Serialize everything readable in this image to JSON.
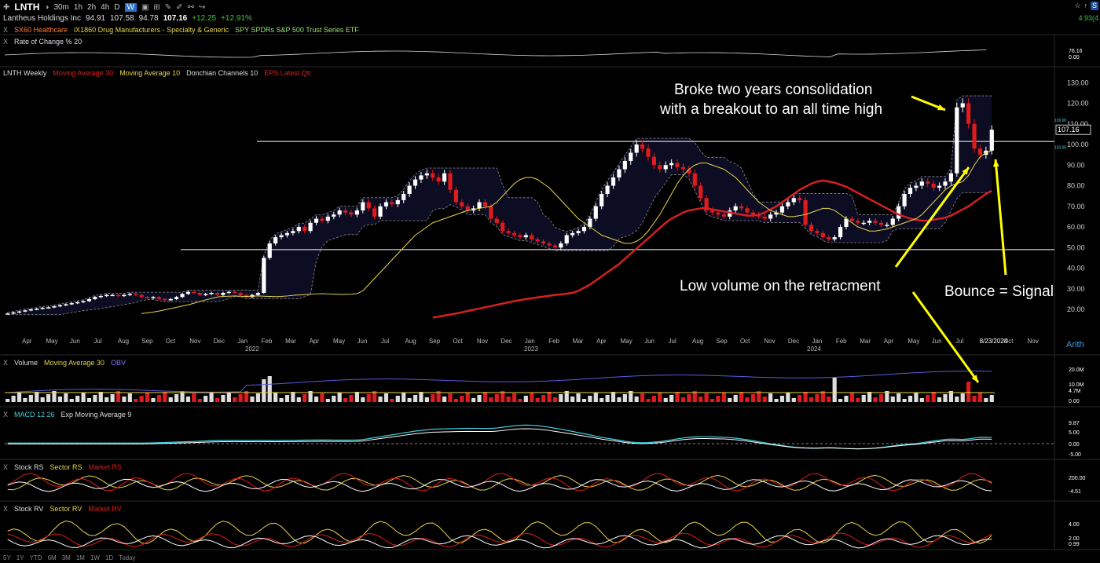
{
  "toolbar": {
    "symbol": "LNTH",
    "timeframes": [
      "30m",
      "1h",
      "2h",
      "4h",
      "D",
      "W"
    ],
    "active_timeframe": "W"
  },
  "quote": {
    "name": "Lantheus Holdings Inc",
    "open": "94.91",
    "high": "107.58",
    "low": "94.78",
    "last": "107.16",
    "change": "+12.25",
    "change_pct": "+12.91%"
  },
  "right_header": {
    "badge": "S",
    "change_label": "4.93(4"
  },
  "comparisons": [
    "SX60 Healthcare",
    "iX1860 Drug Manufacturers - Specialty & Generic",
    "SPY SPDRs S&P 500 Trust Series ETF"
  ],
  "panels": {
    "roc": {
      "x": "X",
      "label": "Rate of Change % 20",
      "values": [
        "76.16",
        "0.00"
      ]
    },
    "price": {
      "symbol_label": "LNTH Weekly",
      "ma30": "Moving Average 30",
      "ma10": "Moving Average 10",
      "donchian": "Donchian Channels 10",
      "eps": "EPS Latest Qtr"
    },
    "volume": {
      "x": "X",
      "label": "Volume",
      "ma": "Moving Average 30",
      "obv": "OBV"
    },
    "macd": {
      "x": "X",
      "label": "MACD 12 26",
      "signal": "Exp Moving Average 9",
      "values": [
        "9.87",
        "5.00",
        "0.00",
        "-5.00"
      ]
    },
    "rs": {
      "x": "X",
      "stock": "Stock RS",
      "sector": "Sector RS",
      "market": "Market RS",
      "values": [
        "200.00",
        "-4.51"
      ]
    },
    "rv": {
      "x": "X",
      "stock": "Stock RV",
      "sector": "Sector RV",
      "market": "Market RV",
      "values": [
        "4.00",
        "2.00",
        "0.99"
      ]
    }
  },
  "bottom_timeframes": [
    "5Y",
    "1Y",
    "YTD",
    "6M",
    "3M",
    "1M",
    "1W",
    "1D",
    "Today"
  ],
  "arith_label": "Arith",
  "annotations": {
    "breakout_line1": "Broke two years consolidation",
    "breakout_line2": "with a breakout to an all time high",
    "low_volume": "Low volume on the retracment",
    "bounce": "Bounce = Signal"
  },
  "colors": {
    "up": "#ffffff",
    "down": "#e01b1b",
    "ma30": "#d42020",
    "ma10": "#e8d44d",
    "donchian": "#8a8a8a",
    "obv": "#5a5ae0",
    "macd": "#3fd0e0",
    "signal": "#ffffff",
    "annotation_arrow": "#ffff00"
  },
  "chart_data": {
    "type": "candlestick",
    "title": "LNTH Weekly",
    "price_axis_ticks": [
      "130.00",
      "120.00",
      "110.00",
      "100.00",
      "90.00",
      "80.00",
      "70.00",
      "60.00",
      "50.00",
      "40.00",
      "30.00",
      "20.00"
    ],
    "ylim": [
      12,
      132
    ],
    "last_price_label": "107.16",
    "donchian_labels": [
      "109.90",
      "103.95"
    ],
    "horizontal_levels": [
      101.5,
      49
    ],
    "x_month_labels": [
      "Apr",
      "May",
      "Jun",
      "Jul",
      "Aug",
      "Sep",
      "Oct",
      "Nov",
      "Dec",
      "Jan",
      "Feb",
      "Mar",
      "Apr",
      "May",
      "Jun",
      "Jul",
      "Aug",
      "Sep",
      "Oct",
      "Nov",
      "Dec",
      "Jan",
      "Feb",
      "Mar",
      "Apr",
      "May",
      "Jun",
      "Jul",
      "Aug",
      "Sep",
      "Oct",
      "Nov",
      "Dec",
      "Jan",
      "Feb",
      "Mar",
      "Apr",
      "May",
      "Jun",
      "Jul",
      "8/23/2024",
      "Oct",
      "Nov"
    ],
    "year_labels": [
      "2022",
      "2023",
      "2024"
    ],
    "close_series": [
      18,
      18.5,
      19,
      19.5,
      20,
      20.3,
      20.8,
      21,
      21.5,
      22,
      22.5,
      23,
      23.5,
      24,
      25,
      26,
      26.5,
      27,
      27,
      26.5,
      27,
      27.5,
      27,
      26,
      25.5,
      26,
      25,
      24.5,
      25,
      26,
      27.5,
      28.5,
      28,
      27,
      27.5,
      28,
      27,
      28,
      28.5,
      28,
      27,
      26,
      27,
      28,
      45,
      52,
      55,
      56,
      57,
      58,
      60,
      58,
      62,
      64,
      63,
      65,
      66,
      68,
      67,
      66,
      68,
      72,
      69,
      65,
      70,
      72,
      71,
      73,
      76,
      80,
      83,
      85,
      86,
      84,
      82,
      86,
      78,
      72,
      70,
      68,
      69,
      72,
      70,
      64,
      62,
      58,
      57,
      56,
      55,
      56,
      54,
      53,
      52,
      51,
      50,
      52,
      56,
      57,
      58,
      60,
      64,
      70,
      76,
      80,
      84,
      88,
      92,
      96,
      100,
      98,
      94,
      90,
      88,
      90,
      91,
      89,
      88,
      86,
      80,
      74,
      68,
      67,
      66,
      65,
      68,
      70,
      69,
      67,
      66,
      65,
      64,
      66,
      67,
      70,
      72,
      74,
      73,
      61,
      58,
      57,
      55,
      54,
      55,
      60,
      64,
      63,
      62,
      62,
      63,
      62,
      61,
      61,
      64,
      70,
      76,
      79,
      80,
      82,
      81,
      79,
      80,
      82,
      86,
      118,
      120,
      110,
      98,
      95,
      97,
      107.16
    ],
    "ma10_series": [
      18,
      18.3,
      18.7,
      19.2,
      19.8,
      20.4,
      21,
      21.6,
      22.2,
      23,
      23.8,
      24.6,
      25.3,
      26,
      26.3,
      26.4,
      26.5,
      26.4,
      26.3,
      26.4,
      26.5,
      26.4,
      26.3,
      26.2,
      26.3,
      26.5,
      26.8,
      27,
      27.2,
      27.4,
      27.5,
      27.6,
      27.5,
      27.4,
      27.3,
      27.3,
      27.4,
      27.6,
      29,
      32,
      35,
      38,
      41,
      44,
      47,
      50,
      53,
      56,
      58,
      60,
      62,
      63,
      64,
      65,
      66,
      67,
      68,
      68.5,
      69,
      69.5,
      70,
      72,
      75,
      78,
      81,
      83,
      84,
      84,
      83,
      81,
      79,
      76,
      73,
      70,
      67,
      64,
      62,
      60,
      58,
      56,
      55,
      54,
      53,
      52,
      52,
      53,
      55,
      58,
      62,
      66,
      71,
      76,
      81,
      85,
      88,
      90,
      91,
      91,
      90,
      89,
      88,
      86,
      84,
      81,
      78,
      75,
      72,
      70,
      68,
      67,
      66,
      65,
      65,
      65.5,
      66,
      67,
      68,
      69,
      69,
      68,
      66,
      64,
      62,
      60,
      59,
      58,
      58,
      58.5,
      59,
      60,
      61,
      62,
      63,
      64,
      66,
      69,
      72,
      75,
      78,
      80,
      81,
      82,
      85,
      90,
      94,
      96,
      97
    ],
    "ma30_series": [
      16,
      16.5,
      17,
      17.5,
      18,
      18.6,
      19.2,
      19.8,
      20.4,
      21,
      21.6,
      22.2,
      22.8,
      23.4,
      24,
      24.5,
      25,
      25.4,
      25.8,
      26.2,
      26.6,
      27,
      27.3,
      27.6,
      28,
      29,
      30.5,
      32,
      34,
      36,
      38,
      40,
      42,
      44.5,
      47,
      49.5,
      52,
      54.5,
      57,
      59.5,
      62,
      64,
      65.5,
      67,
      68,
      68.5,
      69,
      69,
      68.5,
      68,
      67.5,
      67,
      66.5,
      66,
      65.5,
      65.5,
      66,
      67,
      68.5,
      70,
      72,
      74,
      76,
      78,
      79.5,
      81,
      82,
      82.5,
      82,
      81.5,
      80.5,
      79.5,
      78,
      76.5,
      75,
      73.5,
      72,
      70.5,
      69,
      67.5,
      66,
      65,
      64,
      63.5,
      63,
      63,
      63.5,
      64,
      64.5,
      65.5,
      67,
      68.5,
      70,
      72,
      74,
      76,
      77.5
    ]
  }
}
